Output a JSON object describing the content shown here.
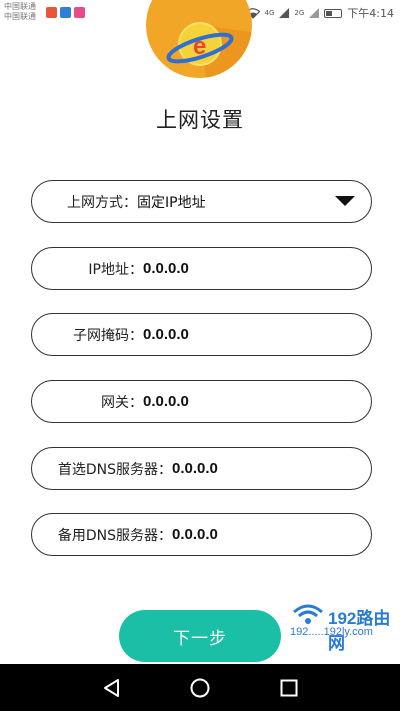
{
  "status_bar": {
    "carrier_line1": "中国联通",
    "carrier_line2": "中国联通",
    "signal_4g": "4G",
    "signal_2g": "2G",
    "time": "下午4:14",
    "app_colors": [
      "#e9553a",
      "#2f7ed8",
      "#e84a8a"
    ]
  },
  "page": {
    "title": "上网设置"
  },
  "fields": {
    "mode": {
      "label": "上网方式：",
      "value": "固定IP地址"
    },
    "ip": {
      "label": "IP地址：",
      "value": "0.0.0.0"
    },
    "mask": {
      "label": "子网掩码：",
      "value": "0.0.0.0"
    },
    "gateway": {
      "label": "网关：",
      "value": "0.0.0.0"
    },
    "dns_primary": {
      "label": "首选DNS服务器：",
      "value": "0.0.0.0"
    },
    "dns_backup": {
      "label": "备用DNS服务器：",
      "value": "0.0.0.0"
    }
  },
  "actions": {
    "next_label": "下一步"
  },
  "watermark": {
    "brand": "192路由网",
    "sub": "192.....192ly.com"
  },
  "colors": {
    "accent": "#1bbfa6",
    "logo_orange": "#f2a627",
    "border": "#333333"
  },
  "icons": {
    "nav_back": "back-triangle-icon",
    "nav_home": "home-circle-icon",
    "nav_recent": "recent-square-icon"
  }
}
